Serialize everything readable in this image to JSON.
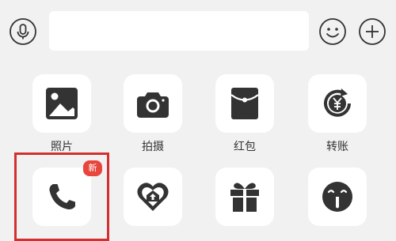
{
  "colors": {
    "background": "#f1f1f1",
    "tile_bg": "#ffffff",
    "icon": "#333333",
    "badge": "#e8453c",
    "highlight_border": "#d32f2f"
  },
  "input_bar": {
    "mic_icon": "microphone-icon",
    "emoji_icon": "smiley-icon",
    "plus_icon": "plus-circle-icon",
    "input_value": ""
  },
  "grid": {
    "items": [
      {
        "label": "照片",
        "icon": "photo-icon"
      },
      {
        "label": "拍摄",
        "icon": "camera-icon"
      },
      {
        "label": "红包",
        "icon": "red-envelope-icon"
      },
      {
        "label": "转账",
        "icon": "transfer-icon"
      },
      {
        "label": "",
        "icon": "phone-icon",
        "badge": "新"
      },
      {
        "label": "",
        "icon": "heart-location-icon"
      },
      {
        "label": "",
        "icon": "gift-icon"
      },
      {
        "label": "",
        "icon": "tickle-face-icon"
      }
    ]
  }
}
